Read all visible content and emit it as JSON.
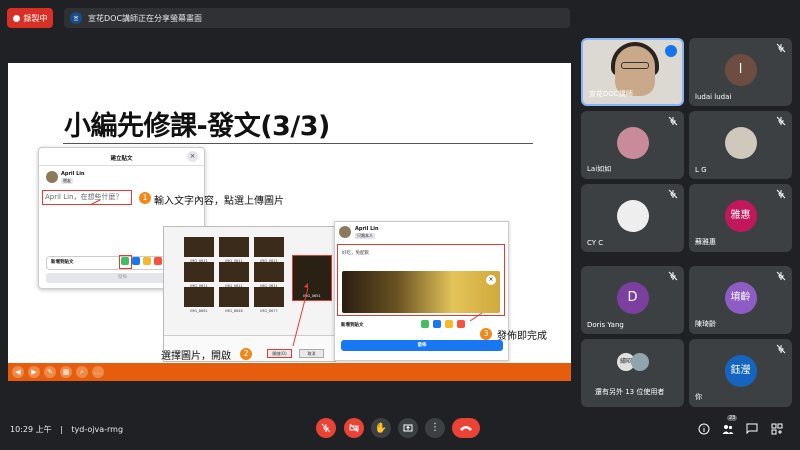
{
  "recording": {
    "label": "錄製中"
  },
  "presenter": {
    "avatar_text": "宣",
    "banner": "宣花DOC講師正在分享螢幕畫面"
  },
  "slide": {
    "title": "小編先修課-發文(3/3)",
    "post_dialog": {
      "title": "建立貼文",
      "author": "April Lin",
      "audience": "朋友",
      "placeholder": "April Lin，在想些什麼？",
      "add_to_post": "新增到貼文",
      "submit": "發佈"
    },
    "callouts": [
      {
        "num": "1",
        "text": "輸入文字內容，點選上傳圖片"
      },
      {
        "num": "2",
        "text": "選擇圖片，開啟"
      },
      {
        "num": "3",
        "text": "發佈即完成"
      }
    ],
    "picker": {
      "thumbnails": [
        "IMG_0611",
        "IMG_0611",
        "IMG_0611",
        "IMG_0611",
        "IMG_0611",
        "IMG_0611",
        "IMG_8661",
        "IMG_8646",
        "IMG_8677"
      ],
      "selected_caption": "IMG_0651",
      "open_button": "開啟(O)",
      "cancel_button": "取消"
    },
    "done_dialog": {
      "author": "April Lin",
      "audience": "只限本人",
      "text": "好吃，免配飲",
      "add_to_post": "新增到貼文",
      "publish": "發佈"
    }
  },
  "participants": [
    {
      "name": "宣花DOC講師",
      "kind": "camera"
    },
    {
      "name": "ludai ludai",
      "kind": "letter",
      "letter": "l",
      "color": "#6d4c41"
    },
    {
      "name": "Lai如如",
      "kind": "photo",
      "color": "#c98b9a"
    },
    {
      "name": "L G",
      "kind": "photo",
      "color": "#cfc8bd"
    },
    {
      "name": "CY C",
      "kind": "photo",
      "color": "#eeeeee"
    },
    {
      "name": "蘇雅惠",
      "kind": "letter",
      "letter": "雅惠",
      "color": "#c2185b"
    },
    {
      "name": "Doris Yang",
      "kind": "letter",
      "letter": "D",
      "color": "#7b3fa0"
    },
    {
      "name": "陳琦齡",
      "kind": "letter",
      "letter": "堉齡",
      "color": "#8e5cc5"
    },
    {
      "name": "還有另外 13 位使用者",
      "kind": "others",
      "letter": "繡昭"
    },
    {
      "name": "你",
      "kind": "letter",
      "letter": "鈺瀅",
      "color": "#1565c0"
    }
  ],
  "meeting": {
    "time": "10:29 上午",
    "separator": "|",
    "code": "tyd-ojva-rmg",
    "people_count": "23"
  }
}
